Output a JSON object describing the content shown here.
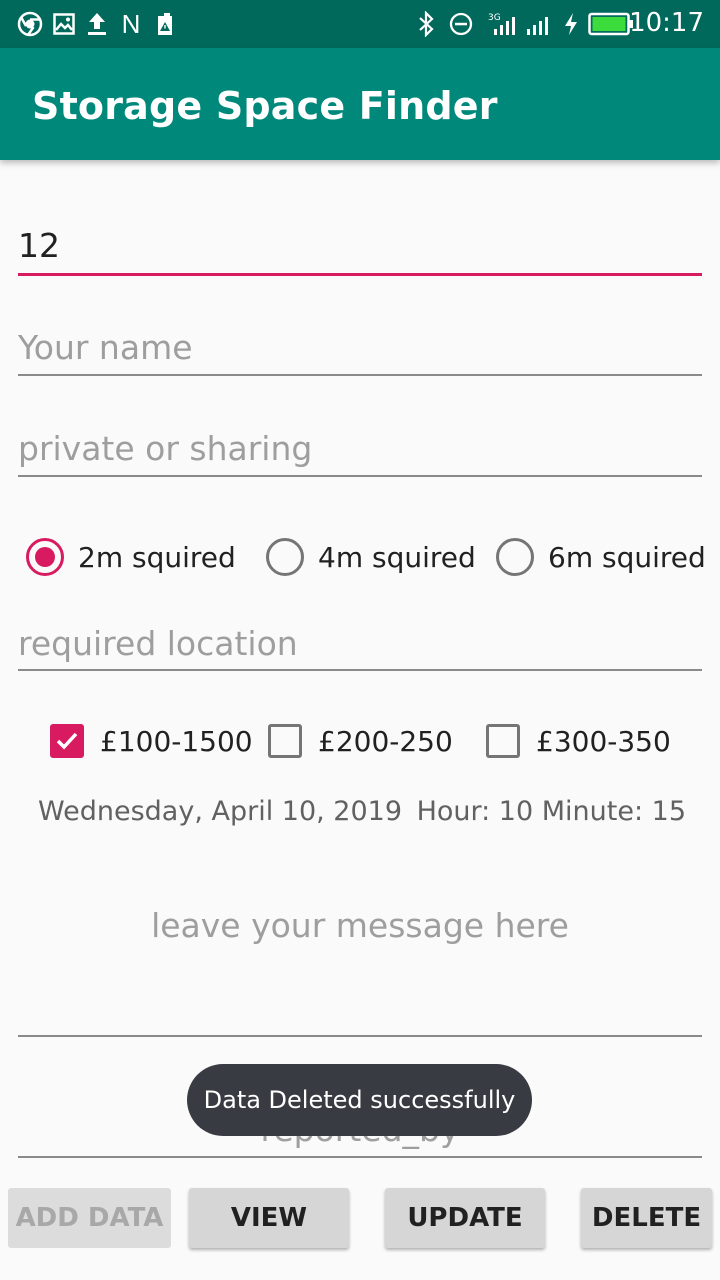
{
  "status_bar": {
    "time": "10:17",
    "icons": [
      "chrome-icon",
      "image-icon",
      "upload-icon",
      "n-icon",
      "storage-alert-icon",
      "bluetooth-icon",
      "do-not-disturb-icon",
      "signal-3g-icon",
      "signal-icon",
      "charging-icon",
      "battery-icon"
    ],
    "network_label": "3G"
  },
  "app_bar": {
    "title": "Storage Space Finder"
  },
  "form": {
    "id_field": {
      "value": "12"
    },
    "name_field": {
      "placeholder": "Your name"
    },
    "type_field": {
      "placeholder": "private or sharing"
    },
    "size_options": [
      {
        "label": "2m squired",
        "checked": true
      },
      {
        "label": "4m squired",
        "checked": false
      },
      {
        "label": "6m squired",
        "checked": false
      }
    ],
    "location_field": {
      "placeholder": "required location"
    },
    "price_options": [
      {
        "label": "£100-1500",
        "checked": true
      },
      {
        "label": "£200-250",
        "checked": false
      },
      {
        "label": "£300-350",
        "checked": false
      }
    ],
    "date_text": "Wednesday, April 10, 2019",
    "time_text": "Hour: 10 Minute: 15",
    "message_field": {
      "placeholder": "leave your message here"
    },
    "reported_by_field": {
      "placeholder": "reported_by"
    }
  },
  "toast": {
    "text": "Data Deleted successfully"
  },
  "buttons": {
    "add": {
      "label": "ADD DATA",
      "enabled": false
    },
    "view": {
      "label": "VIEW",
      "enabled": true
    },
    "update": {
      "label": "UPDATE",
      "enabled": true
    },
    "delete": {
      "label": "DELETE",
      "enabled": true
    }
  },
  "colors": {
    "status_bar": "#00695c",
    "app_bar": "#00897b",
    "accent": "#d81b60",
    "toast_bg": "#383c42",
    "button_bg": "#d6d6d6"
  }
}
